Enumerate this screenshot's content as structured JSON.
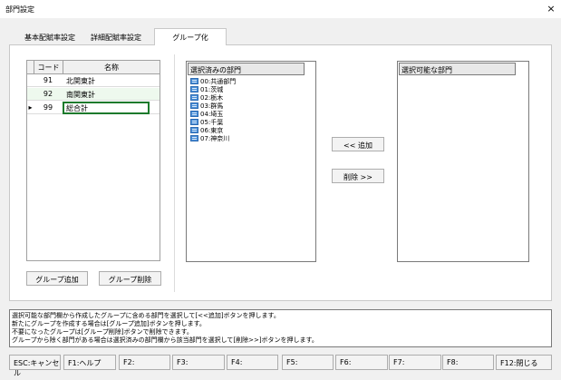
{
  "window": {
    "title": "部門設定",
    "close": "×"
  },
  "tabs": [
    {
      "label": "基本配賦率設定",
      "active": false
    },
    {
      "label": "詳細配賦率設定",
      "active": false
    },
    {
      "label": "グループ化",
      "active": true
    }
  ],
  "group_grid": {
    "headers": {
      "code": "コード",
      "name": "名称"
    },
    "rows": [
      {
        "code": "91",
        "name": "北関東計"
      },
      {
        "code": "92",
        "name": "南関東計"
      },
      {
        "code": "99",
        "name": "総合計"
      }
    ],
    "current_row_marker": "▸"
  },
  "group_buttons": {
    "add": "グループ追加",
    "delete": "グループ削除"
  },
  "selected_list": {
    "header": "選択済みの部門",
    "items": [
      "00:共通部門",
      "01:茨城",
      "02:栃木",
      "03:群馬",
      "04:埼玉",
      "05:千葉",
      "06:東京",
      "07:神奈川"
    ]
  },
  "available_list": {
    "header": "選択可能な部門",
    "items": []
  },
  "transfer_buttons": {
    "add": "<< 追加",
    "remove": "削除 >>"
  },
  "help_lines": [
    "選択可能な部門欄から作成したグループに含める部門を選択して[<<追加]ボタンを押します。",
    "新たにグループを作成する場合は[グループ追加]ボタンを押します。",
    "不要になったグループは[グループ削除]ボタンで削除できます。",
    "グループから除く部門がある場合は選択済みの部門欄から該当部門を選択して[削除>>]ボタンを押します。"
  ],
  "function_keys": [
    "ESC:キャンセル",
    "F1:ヘルプ",
    "F2:",
    "F3:",
    "F4:",
    "F5:",
    "F6:",
    "F7:",
    "F8:",
    "F12:閉じる"
  ],
  "colors": {
    "row_highlight": "#eef9ee",
    "row_selected_border": "#1d7a2c"
  }
}
